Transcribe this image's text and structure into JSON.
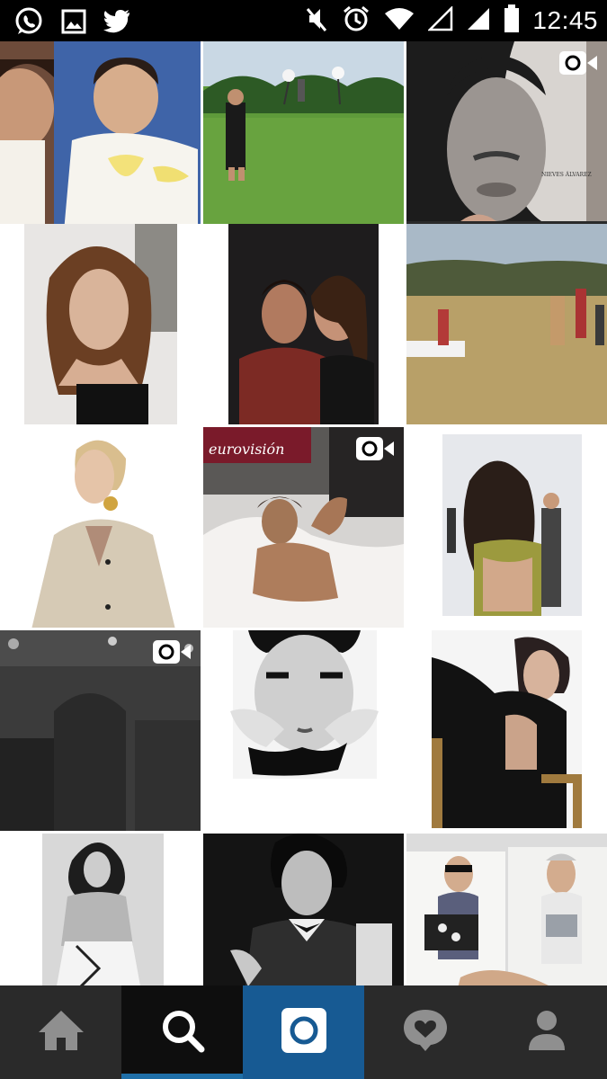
{
  "status_bar": {
    "time": "12:45",
    "left_icons": [
      "whatsapp-icon",
      "gallery-icon",
      "twitter-icon"
    ],
    "right_icons": [
      "mute-icon",
      "alarm-icon",
      "wifi-icon",
      "signal-icon",
      "cell-signal-icon",
      "battery-icon"
    ]
  },
  "grid": {
    "tiles": [
      {
        "id": "1",
        "video": false,
        "caption": ""
      },
      {
        "id": "2",
        "video": false,
        "caption": ""
      },
      {
        "id": "3",
        "video": true,
        "caption": "NIEVES ÁLVAREZ"
      },
      {
        "id": "4",
        "video": false,
        "caption": ""
      },
      {
        "id": "5",
        "video": false,
        "caption": ""
      },
      {
        "id": "6",
        "video": false,
        "caption": ""
      },
      {
        "id": "7",
        "video": false,
        "caption": ""
      },
      {
        "id": "8",
        "video": true,
        "caption": "eurovisión"
      },
      {
        "id": "9",
        "video": false,
        "caption": ""
      },
      {
        "id": "10",
        "video": true,
        "caption": ""
      },
      {
        "id": "11",
        "video": false,
        "caption": ""
      },
      {
        "id": "12",
        "video": false,
        "caption": ""
      },
      {
        "id": "13",
        "video": false,
        "caption": ""
      },
      {
        "id": "14",
        "video": false,
        "caption": ""
      },
      {
        "id": "15",
        "video": false,
        "caption": ""
      }
    ]
  },
  "bottom_nav": {
    "items": [
      {
        "name": "home",
        "icon": "home-icon"
      },
      {
        "name": "explore",
        "icon": "search-icon",
        "active": true
      },
      {
        "name": "camera",
        "icon": "camera-icon"
      },
      {
        "name": "activity",
        "icon": "heart-bubble-icon"
      },
      {
        "name": "profile",
        "icon": "person-icon"
      }
    ]
  },
  "colors": {
    "nav_bg": "#2a2a2a",
    "nav_active_bg": "#0e0e0e",
    "accent_blue": "#1f6fa8",
    "camera_bg": "#175a93"
  }
}
